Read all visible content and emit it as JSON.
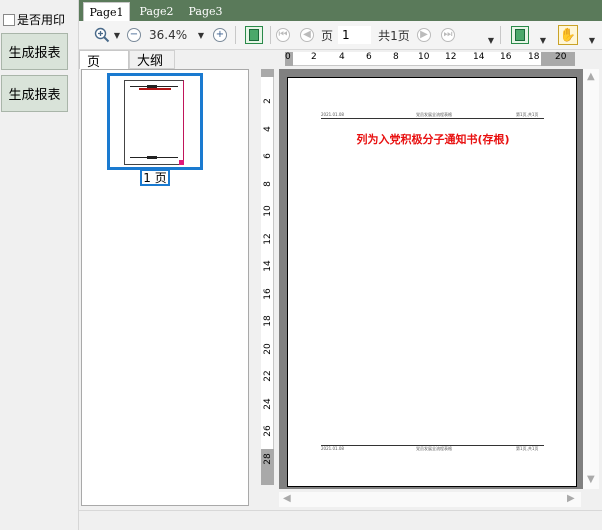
{
  "left": {
    "checkbox_label": "是否用印",
    "buttons": [
      "生成报表",
      "生成报表"
    ]
  },
  "tabs": [
    "Page1",
    "Page2",
    "Page3"
  ],
  "toolbar": {
    "zoom": "36.4%",
    "page_label": "页",
    "page_value": "1",
    "total_label": "共1页"
  },
  "panel_tabs": [
    "页",
    "大纲"
  ],
  "thumbnail": {
    "label": "1 页"
  },
  "ruler_h": [
    "0",
    "2",
    "4",
    "6",
    "8",
    "10",
    "12",
    "14",
    "16",
    "18",
    "20"
  ],
  "ruler_v": [
    "2",
    "4",
    "6",
    "8",
    "10",
    "12",
    "14",
    "16",
    "18",
    "20",
    "22",
    "24",
    "26",
    "28"
  ],
  "document": {
    "title": "列为入党积极分子通知书(存根)",
    "header_left": "2021.01.08",
    "header_center": "党员发展全流程表格",
    "header_right": "第1页,共1页",
    "footer_left": "2021.01.08",
    "footer_center": "党员发展全流程表格",
    "footer_right": "第1页,共1页"
  },
  "colors": {
    "tabbar": "#5a7a5a",
    "title_red": "#e81010",
    "accent_blue": "#1a7ad0"
  }
}
